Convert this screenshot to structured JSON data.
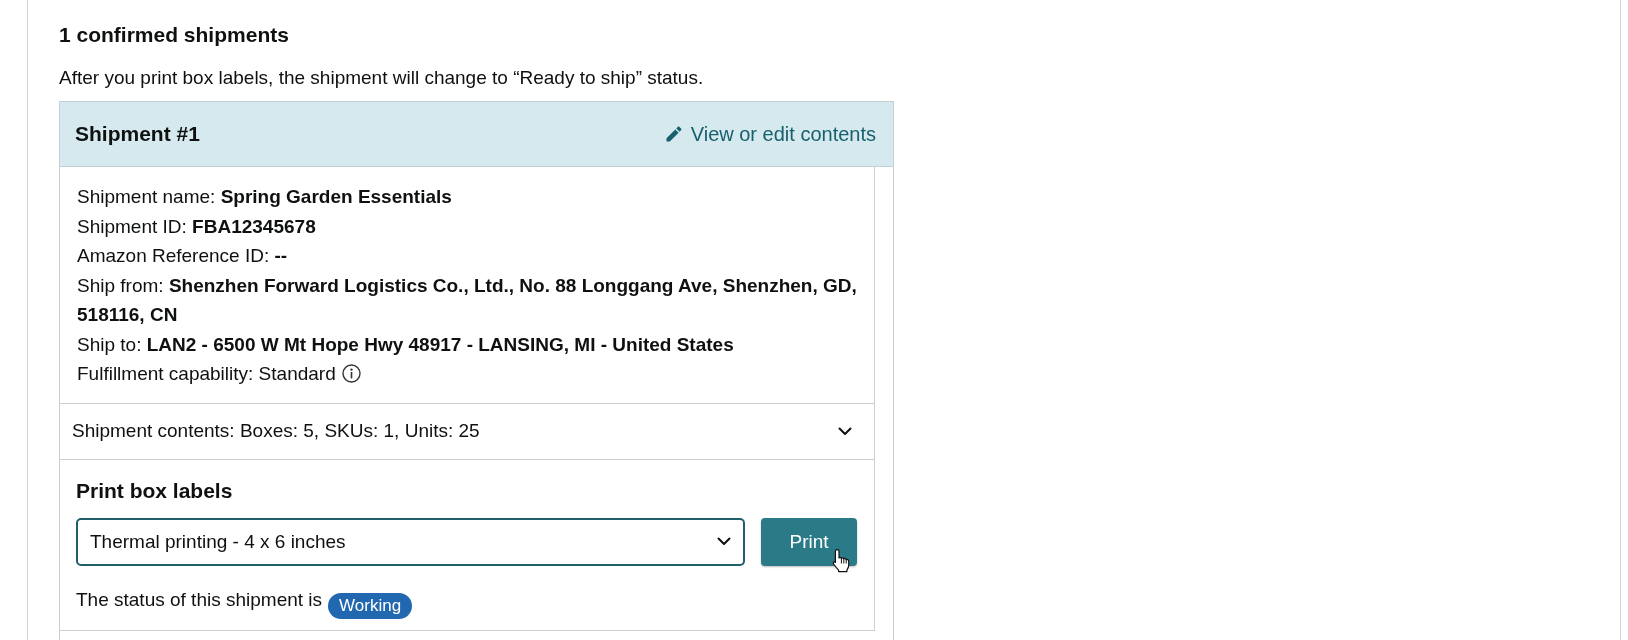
{
  "summary": {
    "heading": "1 confirmed shipments",
    "note": "After you print box labels, the shipment will change to “Ready to ship” status."
  },
  "shipment": {
    "title": "Shipment #1",
    "edit_link": "View or edit contents",
    "details": [
      {
        "kind": "text",
        "text": "Shipment name: **Spring Garden Essentials**"
      },
      {
        "kind": "text",
        "text": "Shipment ID: **FBA12345678**"
      },
      {
        "kind": "text",
        "text": "Amazon Reference ID: **--**"
      },
      {
        "kind": "text",
        "text": "Ship from: **Shenzhen Forward Logistics Co., Ltd., No. 88 Longgang Ave, Shenzhen, GD, 518116, CN**"
      },
      {
        "kind": "text",
        "text": "Ship to: **LAN2 - 6500 W Mt Hope Hwy 48917 - LANSING, MI - United States**"
      },
      {
        "kind": "info",
        "text": "Fulfillment capability: Standard"
      }
    ],
    "contents": {
      "text": "Shipment contents: Boxes: 5, SKUs: 1, Units: 25",
      "expanded": false
    },
    "print_labels": {
      "title": "Print box labels",
      "format": {
        "value": "Thermal printing - 4 x 6 inches"
      },
      "button": "Print"
    },
    "status": {
      "text": "The status of this shipment is",
      "badge": "Working"
    }
  }
}
